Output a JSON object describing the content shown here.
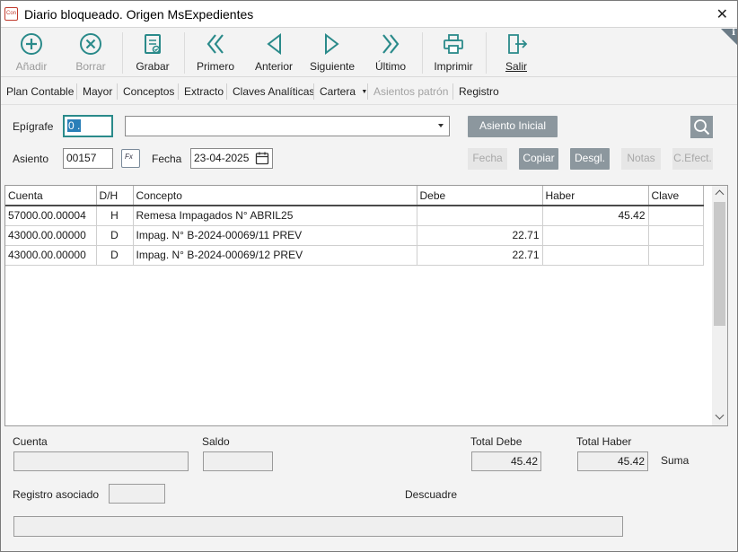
{
  "window": {
    "title": "Diario bloqueado. Origen MsExpedientes",
    "app_icon_text": "Con"
  },
  "toolbar": {
    "items": [
      {
        "id": "add",
        "label": "Añadir",
        "icon": "plus-circle-icon",
        "disabled": true
      },
      {
        "id": "delete",
        "label": "Borrar",
        "icon": "x-circle-icon",
        "disabled": true
      },
      {
        "id": "save",
        "label": "Grabar",
        "icon": "save-document-icon",
        "disabled": false
      },
      {
        "id": "first",
        "label": "Primero",
        "icon": "double-chevron-left-icon",
        "disabled": false
      },
      {
        "id": "prev",
        "label": "Anterior",
        "icon": "chevron-left-icon",
        "disabled": false
      },
      {
        "id": "next",
        "label": "Siguiente",
        "icon": "chevron-right-icon",
        "disabled": false
      },
      {
        "id": "last",
        "label": "Último",
        "icon": "double-chevron-right-icon",
        "disabled": false
      },
      {
        "id": "print",
        "label": "Imprimir",
        "icon": "printer-icon",
        "disabled": false
      },
      {
        "id": "exit",
        "label": "Salir",
        "icon": "exit-door-icon",
        "disabled": false
      }
    ],
    "info_label": "i"
  },
  "menu": {
    "items": [
      {
        "label": "Plan Contable",
        "disabled": false
      },
      {
        "label": "Mayor",
        "disabled": false
      },
      {
        "label": "Conceptos",
        "disabled": false
      },
      {
        "label": "Extracto",
        "disabled": false
      },
      {
        "label": "Claves Analíticas",
        "disabled": false
      },
      {
        "label": "Cartera",
        "disabled": false,
        "dropdown": true
      },
      {
        "label": "Asientos patrón",
        "disabled": true
      },
      {
        "label": "Registro",
        "disabled": false
      }
    ]
  },
  "form": {
    "epigrafe_label": "Epígrafe",
    "epigrafe_value": "0 .",
    "epigrafe_select_value": "",
    "asiento_inicial_button": "Asiento Inicial",
    "asiento_label": "Asiento",
    "asiento_value": "00157",
    "fx_label": "Fx",
    "fecha_label": "Fecha",
    "fecha_value": "23-04-2025",
    "buttons": {
      "fecha": "Fecha",
      "copiar": "Copiar",
      "desgl": "Desgl.",
      "notas": "Notas",
      "cefect": "C.Efect."
    }
  },
  "grid": {
    "columns": [
      "Cuenta",
      "D/H",
      "Concepto",
      "Debe",
      "Haber",
      "Clave"
    ],
    "rows": [
      {
        "cuenta": "57000.00.00004",
        "dh": "H",
        "concepto": "Remesa Impagados N° ABRIL25",
        "debe": "",
        "haber": "45.42",
        "clave": ""
      },
      {
        "cuenta": "43000.00.00000",
        "dh": "D",
        "concepto": "Impag. N° B-2024-00069/11 PREV",
        "debe": "22.71",
        "haber": "",
        "clave": ""
      },
      {
        "cuenta": "43000.00.00000",
        "dh": "D",
        "concepto": "Impag. N° B-2024-00069/12 PREV",
        "debe": "22.71",
        "haber": "",
        "clave": ""
      }
    ]
  },
  "footer": {
    "cuenta_label": "Cuenta",
    "cuenta_value": "",
    "saldo_label": "Saldo",
    "saldo_value": "",
    "total_debe_label": "Total Debe",
    "total_debe_value": "45.42",
    "total_haber_label": "Total Haber",
    "total_haber_value": "45.42",
    "suma_label": "Suma",
    "registro_label": "Registro asociado",
    "registro_value": "",
    "descuadre_label": "Descuadre",
    "descuadre_value": ""
  },
  "colors": {
    "accent": "#2a8a8a",
    "icon": "#2a8a8a",
    "button_grey": "#8c979e"
  }
}
